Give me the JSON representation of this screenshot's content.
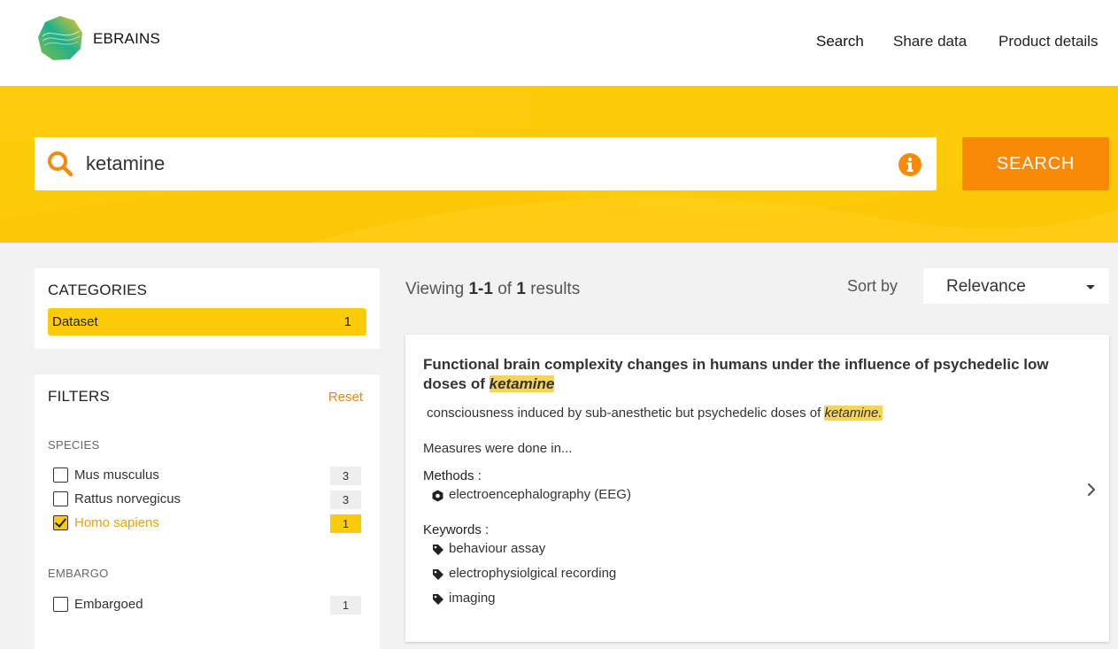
{
  "header": {
    "brand": "EBRAINS",
    "nav": [
      "Search",
      "Share data",
      "Product details"
    ]
  },
  "search": {
    "query": "ketamine",
    "button_label": "SEARCH"
  },
  "categories": {
    "title": "CATEGORIES",
    "items": [
      {
        "label": "Dataset",
        "count": "1"
      }
    ]
  },
  "filters": {
    "title": "FILTERS",
    "reset_label": "Reset",
    "species": {
      "title": "SPECIES",
      "items": [
        {
          "label": "Mus musculus",
          "count": "3",
          "checked": false
        },
        {
          "label": "Rattus norvegicus",
          "count": "3",
          "checked": false
        },
        {
          "label": "Homo sapiens",
          "count": "1",
          "checked": true
        }
      ]
    },
    "embargo": {
      "title": "EMBARGO",
      "items": [
        {
          "label": "Embargoed",
          "count": "1",
          "checked": false
        }
      ]
    }
  },
  "results": {
    "viewing_prefix": "Viewing",
    "range": "1-1",
    "of": "of",
    "total": "1",
    "suffix": "results",
    "sort_label": "Sort by",
    "sort_value": "Relevance"
  },
  "result_card": {
    "title_text": "Functional brain complexity changes in humans under the influence of psychedelic low doses of",
    "title_highlight": "ketamine",
    "snippet_text": "consciousness induced by sub-anesthetic but psychedelic doses of",
    "snippet_highlight": "ketamine.",
    "more_text": "Measures were done in...",
    "methods_label": "Methods",
    "methods": [
      "electroencephalography (EEG)"
    ],
    "keywords_label": "Keywords",
    "keywords": [
      "behaviour assay",
      "electrophysiolgical recording",
      "imaging"
    ]
  },
  "colors": {
    "brand_yellow": "#fdcb0a",
    "accent_orange": "#f98a08",
    "highlight": "#f4d35e"
  },
  "icons": [
    "ebrains-logo",
    "search-icon",
    "info-icon",
    "checkbox-icon",
    "hexagon-icon",
    "tag-icon",
    "chevron-right-icon",
    "caret-down-icon"
  ]
}
